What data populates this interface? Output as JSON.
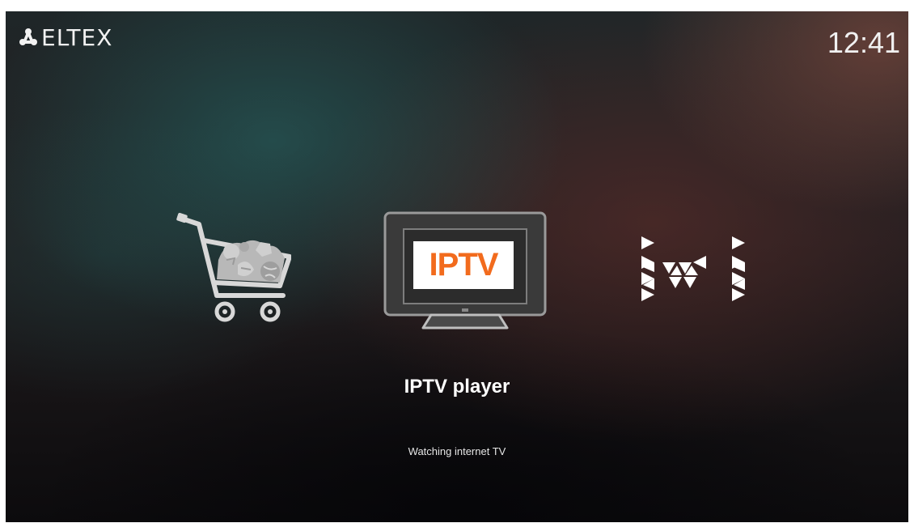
{
  "header": {
    "brand": "ELTEX",
    "brand_icon": "eltex-logo-icon",
    "clock": "12:41"
  },
  "apps": [
    {
      "id": "store",
      "icon": "shopping-cart-icon"
    },
    {
      "id": "iptv",
      "icon": "tv-icon",
      "badge": "IPTV"
    },
    {
      "id": "ivi",
      "icon": "ivi-logo-icon"
    }
  ],
  "selected": {
    "title": "IPTV player",
    "description": "Watching internet TV"
  },
  "colors": {
    "iptv_badge_text": "#f26b1d",
    "text": "#ffffff"
  }
}
